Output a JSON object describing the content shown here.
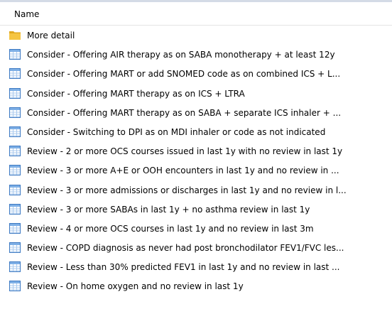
{
  "header": {
    "name_column": "Name"
  },
  "rows": [
    {
      "icon": "folder-icon",
      "label": "More detail"
    },
    {
      "icon": "report-icon",
      "label": "Consider - Offering AIR therapy as on SABA monotherapy + at least 12y"
    },
    {
      "icon": "report-icon",
      "label": "Consider - Offering MART or add SNOMED code as on combined ICS + L..."
    },
    {
      "icon": "report-icon",
      "label": "Consider - Offering MART therapy as on ICS + LTRA"
    },
    {
      "icon": "report-icon",
      "label": "Consider - Offering MART therapy as on SABA + separate ICS inhaler + ..."
    },
    {
      "icon": "report-icon",
      "label": "Consider - Switching to DPI as on MDI inhaler or code as not indicated"
    },
    {
      "icon": "report-icon",
      "label": "Review - 2 or more OCS courses issued in last 1y with no review in last 1y"
    },
    {
      "icon": "report-icon",
      "label": "Review - 3 or more A+E or OOH encounters in last 1y and no review in ..."
    },
    {
      "icon": "report-icon",
      "label": "Review - 3 or more admissions or discharges in last 1y and no review in l..."
    },
    {
      "icon": "report-icon",
      "label": "Review - 3 or more SABAs in last 1y + no asthma review in last 1y"
    },
    {
      "icon": "report-icon",
      "label": "Review - 4 or more OCS courses in last 1y and no review in last 3m"
    },
    {
      "icon": "report-icon",
      "label": "Review - COPD diagnosis as never had post bronchodilator FEV1/FVC les..."
    },
    {
      "icon": "report-icon",
      "label": "Review - Less than 30% predicted FEV1 in last 1y and no review in last ..."
    },
    {
      "icon": "report-icon",
      "label": "Review - On home oxygen and no review in last 1y"
    }
  ],
  "colors": {
    "folder": "#f5c542",
    "folder_dark": "#e0a820",
    "report_border": "#3b78c2",
    "report_header": "#7fb0e6",
    "report_grid": "#a9c9ee"
  }
}
